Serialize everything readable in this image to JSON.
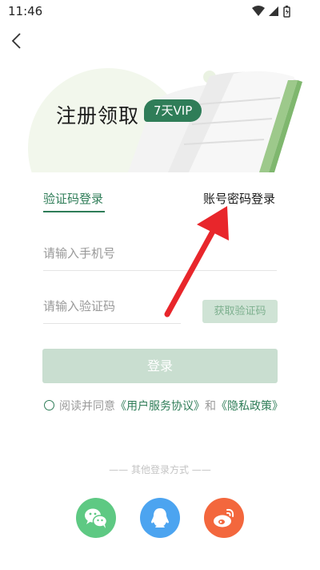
{
  "status_bar": {
    "time": "11:46"
  },
  "banner": {
    "title": "注册领取",
    "badge": "7天VIP"
  },
  "tabs": {
    "sms_login": "验证码登录",
    "password_login": "账号密码登录"
  },
  "form": {
    "phone_placeholder": "请输入手机号",
    "code_placeholder": "请输入验证码",
    "get_code_label": "获取验证码",
    "login_label": "登录"
  },
  "agreement": {
    "prefix": "阅读并同意",
    "service_link": "《用户服务协议》",
    "and": "和",
    "privacy_link": "《隐私政策》"
  },
  "other_login": {
    "label": "—— 其他登录方式 ——"
  },
  "social": [
    "wechat-icon",
    "qq-icon",
    "weibo-icon"
  ],
  "colors": {
    "accent": "#2f7d58",
    "arrow": "#e8262b"
  }
}
